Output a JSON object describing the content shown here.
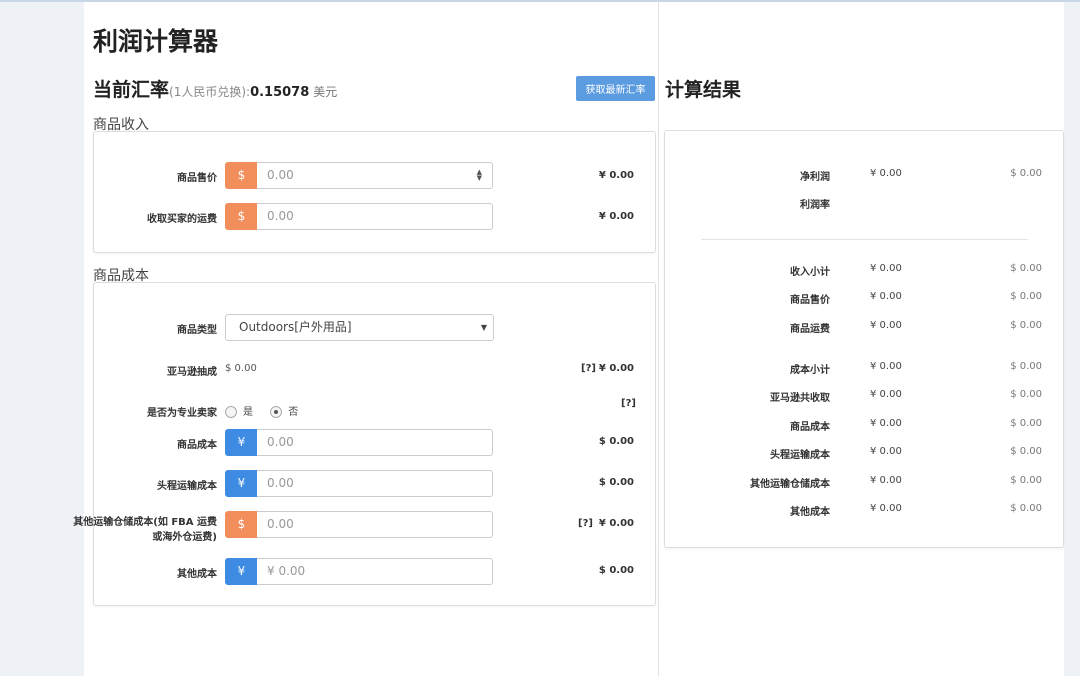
{
  "title": "利润计算器",
  "rate": {
    "label": "当前汇率",
    "note": "(1人民币兑换):",
    "value": "0.15078",
    "unit": "美元",
    "button": "获取最新汇率"
  },
  "income": {
    "title": "商品收入",
    "price": {
      "label": "商品售价",
      "addon": "$",
      "placeholder": "0.00",
      "result": "¥ 0.00"
    },
    "shipping": {
      "label": "收取买家的运费",
      "addon": "$",
      "placeholder": "0.00",
      "result": "¥ 0.00"
    }
  },
  "cost": {
    "title": "商品成本",
    "category": {
      "label": "商品类型",
      "selected": "Outdoors[户外用品]"
    },
    "commission": {
      "label": "亚马逊抽成",
      "value": "$ 0.00",
      "help": "[?]",
      "result": "¥ 0.00"
    },
    "pro_seller": {
      "label": "是否为专业卖家",
      "yes": "是",
      "no": "否",
      "help": "[?]",
      "selected": "否"
    },
    "product_cost": {
      "label": "商品成本",
      "addon": "¥",
      "placeholder": "0.00",
      "result": "$ 0.00"
    },
    "first_leg": {
      "label": "头程运输成本",
      "addon": "¥",
      "placeholder": "0.00",
      "result": "$ 0.00"
    },
    "other_storage": {
      "label": "其他运输仓储成本(如 FBA 运费或海外仓运费)",
      "addon": "$",
      "placeholder": "0.00",
      "help": "[?]",
      "result": "¥ 0.00"
    },
    "other_cost": {
      "label": "其他成本",
      "addon": "¥",
      "placeholder": "¥ 0.00",
      "result": "$ 0.00"
    }
  },
  "results": {
    "title": "计算结果",
    "net_profit": {
      "label": "净利润",
      "cny": "¥ 0.00",
      "usd": "$ 0.00"
    },
    "margin": {
      "label": "利润率"
    },
    "rows": [
      {
        "label": "收入小计",
        "cny": "¥ 0.00",
        "usd": "$ 0.00"
      },
      {
        "label": "商品售价",
        "cny": "¥ 0.00",
        "usd": "$ 0.00"
      },
      {
        "label": "商品运费",
        "cny": "¥ 0.00",
        "usd": "$ 0.00"
      },
      {
        "label": "成本小计",
        "cny": "¥ 0.00",
        "usd": "$ 0.00"
      },
      {
        "label": "亚马逊共收取",
        "cny": "¥ 0.00",
        "usd": "$ 0.00"
      },
      {
        "label": "商品成本",
        "cny": "¥ 0.00",
        "usd": "$ 0.00"
      },
      {
        "label": "头程运输成本",
        "cny": "¥ 0.00",
        "usd": "$ 0.00"
      },
      {
        "label": "其他运输仓储成本",
        "cny": "¥ 0.00",
        "usd": "$ 0.00"
      },
      {
        "label": "其他成本",
        "cny": "¥ 0.00",
        "usd": "$ 0.00"
      }
    ]
  },
  "colors": {
    "accent_blue": "#3e8be3",
    "accent_orange": "#f28e5c",
    "button": "#5b9be0"
  }
}
